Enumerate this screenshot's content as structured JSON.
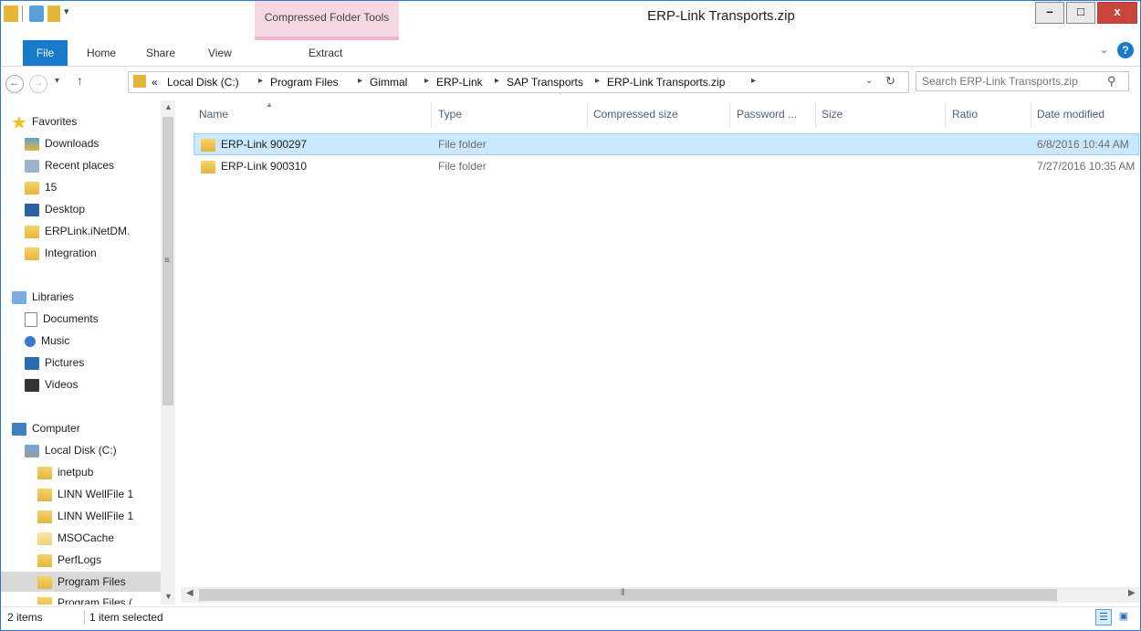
{
  "window": {
    "title": "ERP-Link Transports.zip"
  },
  "contextual_tab": {
    "group": "Compressed Folder Tools",
    "tab": "Extract"
  },
  "ribbon_tabs": [
    "File",
    "Home",
    "Share",
    "View"
  ],
  "window_buttons": {
    "minimize": "–",
    "maximize": "□",
    "close": "x"
  },
  "address": {
    "prefix": "«",
    "crumbs": [
      "Local Disk (C:)",
      "Program Files",
      "Gimmal",
      "ERP-Link",
      "SAP Transports",
      "ERP-Link Transports.zip"
    ],
    "search_placeholder": "Search ERP-Link Transports.zip"
  },
  "nav": {
    "favorites": {
      "label": "Favorites",
      "items": [
        "Downloads",
        "Recent places",
        "15",
        "Desktop",
        "ERPLink.iNetDM.",
        "Integration"
      ]
    },
    "libraries": {
      "label": "Libraries",
      "items": [
        "Documents",
        "Music",
        "Pictures",
        "Videos"
      ]
    },
    "computer": {
      "label": "Computer",
      "drive": "Local Disk (C:)",
      "items": [
        "inetpub",
        "LINN WellFile 1",
        "LINN WellFile 1",
        "MSOCache",
        "PerfLogs",
        "Program Files",
        "Program Files ("
      ]
    }
  },
  "columns": [
    "Name",
    "Type",
    "Compressed size",
    "Password ...",
    "Size",
    "Ratio",
    "Date modified"
  ],
  "files": [
    {
      "name": "ERP-Link 900297",
      "type": "File folder",
      "date": "6/8/2016 10:44 AM",
      "selected": true
    },
    {
      "name": "ERP-Link 900310",
      "type": "File folder",
      "date": "7/27/2016 10:35 AM",
      "selected": false
    }
  ],
  "status": {
    "items": "2 items",
    "selected": "1 item selected"
  },
  "colors": {
    "accent": "#1979ca",
    "contextual": "#f5d8e4",
    "selection": "#cce8ff"
  }
}
